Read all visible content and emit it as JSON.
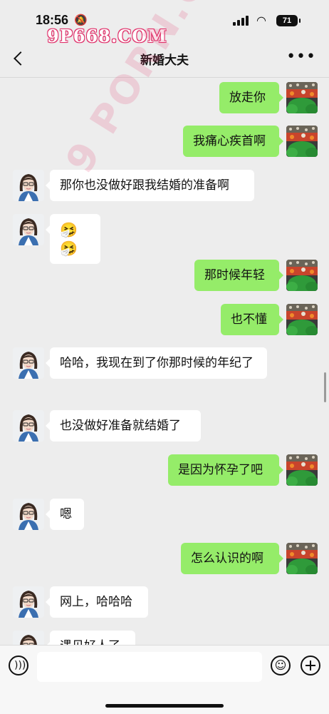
{
  "status": {
    "time": "18:56",
    "battery": "71",
    "watermark": "9P668.COM"
  },
  "header": {
    "title": "新婚大夫"
  },
  "messages": [
    {
      "side": "out",
      "text": "放走你"
    },
    {
      "side": "out",
      "text": "我痛心疾首啊"
    },
    {
      "side": "in",
      "text": "那你也没做好跟我结婚的准备啊"
    },
    {
      "side": "in",
      "text": "🤧🤧"
    },
    {
      "side": "out",
      "text": "那时候年轻"
    },
    {
      "side": "out",
      "text": "也不懂"
    },
    {
      "side": "in",
      "text": "哈哈，我现在到了你那时候的年纪了"
    },
    {
      "side": "in",
      "text": "也没做好准备就结婚了"
    },
    {
      "side": "out",
      "text": "是因为怀孕了吧"
    },
    {
      "side": "in",
      "text": "嗯"
    },
    {
      "side": "out",
      "text": "怎么认识的啊"
    },
    {
      "side": "in",
      "text": "网上，哈哈哈"
    },
    {
      "side": "in",
      "text": "遇见好人了"
    }
  ],
  "icons": {
    "back": "chevron-left-icon",
    "more": "more-icon",
    "voice": "voice-icon",
    "emoji": "emoji-icon",
    "plus": "plus-icon"
  },
  "colors": {
    "out_bubble": "#95ec69",
    "in_bubble": "#ffffff",
    "background": "#ededed"
  }
}
